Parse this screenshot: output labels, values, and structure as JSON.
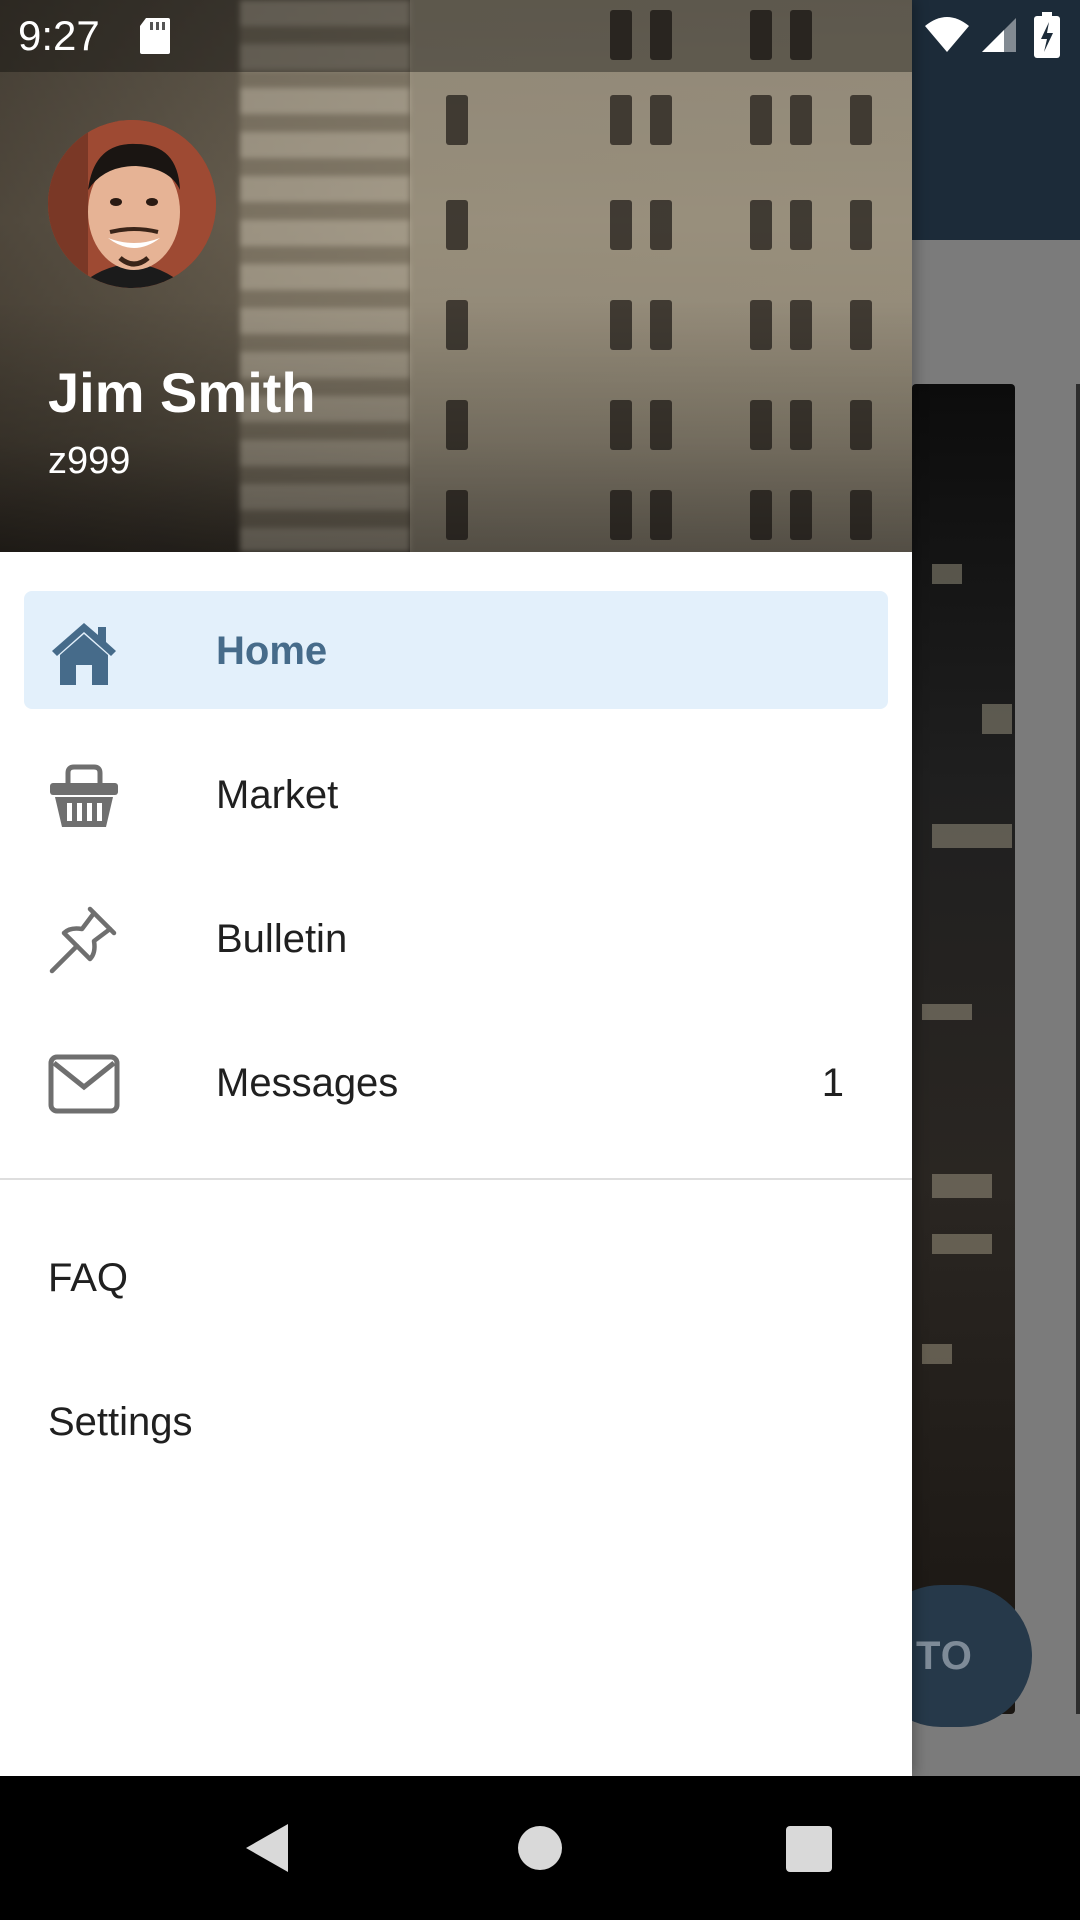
{
  "status_bar": {
    "time": "9:27"
  },
  "background_app": {
    "fab_label": "TO"
  },
  "drawer": {
    "user": {
      "name": "Jim Smith",
      "id": "z999"
    },
    "items": [
      {
        "label": "Home",
        "icon": "home-icon",
        "active": true
      },
      {
        "label": "Market",
        "icon": "basket-icon",
        "active": false
      },
      {
        "label": "Bulletin",
        "icon": "pushpin-icon",
        "active": false
      },
      {
        "label": "Messages",
        "icon": "envelope-icon",
        "active": false,
        "count": "1"
      }
    ],
    "secondary_items": [
      {
        "label": "FAQ"
      },
      {
        "label": "Settings"
      }
    ]
  },
  "colors": {
    "active_bg": "#e3f0fb",
    "active_text": "#466b8a",
    "icon_gray": "#6f6f6f",
    "toolbar": "#1c2b39"
  }
}
